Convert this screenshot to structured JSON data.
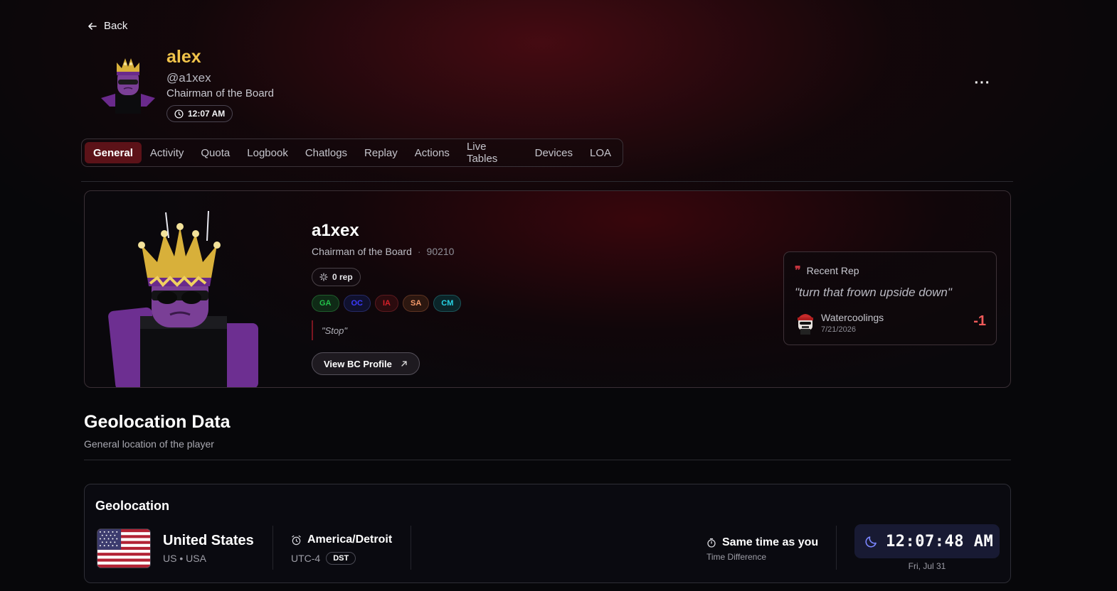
{
  "nav": {
    "back_label": "Back"
  },
  "header": {
    "display_name": "alex",
    "handle": "@a1xex",
    "role": "Chairman of the Board",
    "local_time": "12:07 AM",
    "more_label": "···"
  },
  "tabs": [
    {
      "label": "General",
      "active": true
    },
    {
      "label": "Activity"
    },
    {
      "label": "Quota"
    },
    {
      "label": "Logbook"
    },
    {
      "label": "Chatlogs"
    },
    {
      "label": "Replay"
    },
    {
      "label": "Actions"
    },
    {
      "label": "Live Tables"
    },
    {
      "label": "Devices"
    },
    {
      "label": "LOA"
    }
  ],
  "profile": {
    "username": "a1xex",
    "role": "Chairman of the Board",
    "separator": "·",
    "user_number": "90210",
    "rep": "0 rep",
    "badges": [
      {
        "label": "GA",
        "color": "#23c14a",
        "bg": "#0f2a16",
        "border": "#1f5c2c"
      },
      {
        "label": "OC",
        "color": "#3b3bff",
        "bg": "#10112e",
        "border": "#262a66"
      },
      {
        "label": "IA",
        "color": "#d6202a",
        "bg": "#2b0b0e",
        "border": "#5c1a1f"
      },
      {
        "label": "SA",
        "color": "#f59a6a",
        "bg": "#2c1710",
        "border": "#5e3422"
      },
      {
        "label": "CM",
        "color": "#27d3e6",
        "bg": "#0b2529",
        "border": "#1c5459"
      }
    ],
    "status_quote": "\"Stop\"",
    "bc_button": "View BC Profile"
  },
  "recent_rep": {
    "title": "Recent Rep",
    "quote": "\"turn that frown upside down\"",
    "user": "Watercoolings",
    "date": "7/21/2026",
    "score": "-1"
  },
  "geo_section": {
    "title": "Geolocation Data",
    "subtitle": "General location of the player"
  },
  "geolocation": {
    "title": "Geolocation",
    "country": "United States",
    "country_codes": "US • USA",
    "timezone": "America/Detroit",
    "utc_offset": "UTC-4",
    "dst_label": "DST",
    "time_diff": "Same time as you",
    "time_diff_label": "Time Difference",
    "clock": "12:07:48 AM",
    "date": "Fri, Jul 31"
  },
  "colors": {
    "accent": "#5c1218",
    "name_gold": "#f0c34a",
    "rep_negative": "#f05a5a",
    "clock_bg": "#181a33"
  }
}
